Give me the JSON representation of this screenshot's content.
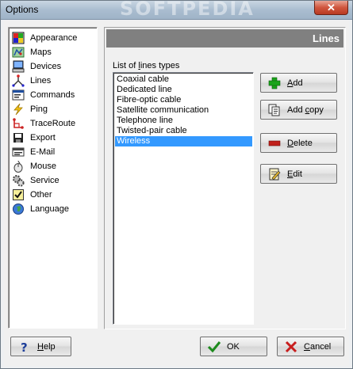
{
  "window": {
    "title": "Options",
    "watermark": "SOFTPEDIA",
    "close_glyph": "✕"
  },
  "nav": {
    "items": [
      {
        "label": "Appearance",
        "icon": "appearance-icon"
      },
      {
        "label": "Maps",
        "icon": "map-icon"
      },
      {
        "label": "Devices",
        "icon": "computer-icon"
      },
      {
        "label": "Lines",
        "icon": "lines-icon"
      },
      {
        "label": "Commands",
        "icon": "commands-icon"
      },
      {
        "label": "Ping",
        "icon": "ping-lightning-icon"
      },
      {
        "label": "TraceRoute",
        "icon": "traceroute-icon"
      },
      {
        "label": "Export",
        "icon": "export-icon"
      },
      {
        "label": "E-Mail",
        "icon": "email-icon"
      },
      {
        "label": "Mouse",
        "icon": "mouse-icon"
      },
      {
        "label": "Service",
        "icon": "service-gear-icon"
      },
      {
        "label": "Other",
        "icon": "checkbox-icon"
      },
      {
        "label": "Language",
        "icon": "globe-icon"
      }
    ]
  },
  "panel": {
    "title": "Lines",
    "list_caption_pre": "List of ",
    "list_caption_underlined": "l",
    "list_caption_post": "ines types",
    "list_items": [
      "Coaxial cable",
      "Dedicated line",
      "Fibre-optic cable",
      "Satellite communication",
      "Telephone line",
      "Twisted-pair cable",
      "Wireless"
    ],
    "selected_item": "Wireless"
  },
  "buttons": {
    "add": {
      "u": "A",
      "rest": "dd"
    },
    "add_copy": {
      "pre": "Add ",
      "u": "c",
      "rest": "opy"
    },
    "delete": {
      "u": "D",
      "rest": "elete"
    },
    "edit": {
      "u": "E",
      "rest": "dit"
    },
    "help": {
      "u": "H",
      "rest": "elp"
    },
    "ok": {
      "label": "OK"
    },
    "cancel": {
      "u": "C",
      "rest": "ancel"
    }
  },
  "colors": {
    "selection": "#3399ff",
    "header_bg": "#808080",
    "add_green": "#1aa31a",
    "delete_red": "#c0201a",
    "ok_green": "#1c8a1c",
    "cancel_red": "#c81e1e"
  }
}
